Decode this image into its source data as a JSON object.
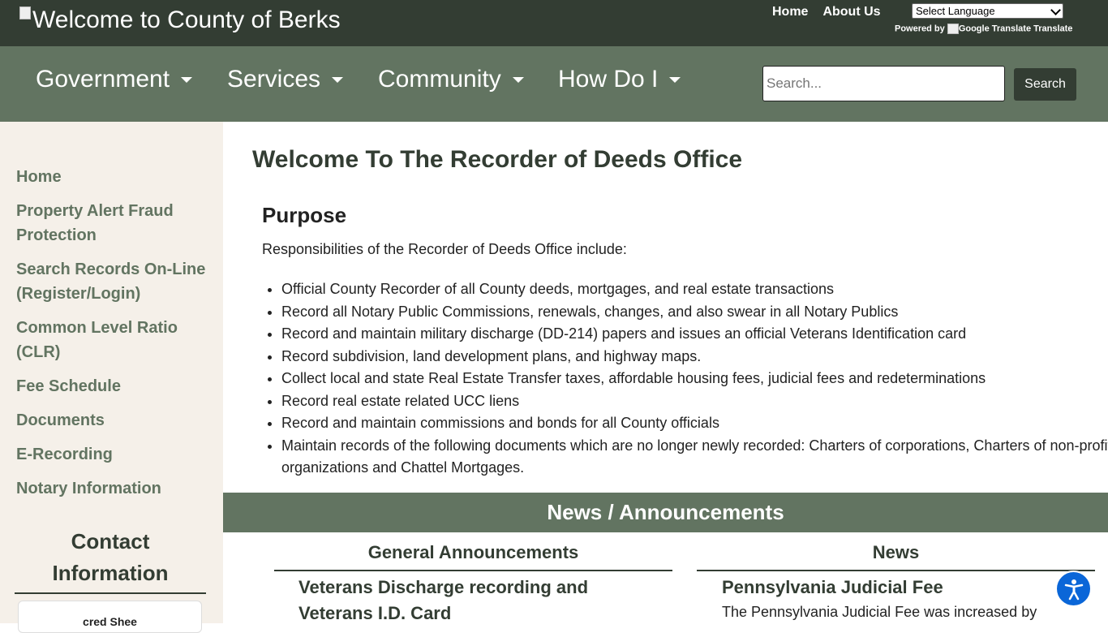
{
  "header": {
    "logo_text": "Welcome to County of Berks",
    "links": [
      "Home",
      "About Us"
    ],
    "language_select": "Select Language",
    "powered_by": "Powered by",
    "google_translate": "Google Translate",
    "translate": "Translate"
  },
  "nav": {
    "items": [
      "Government",
      "Services",
      "Community",
      "How Do I"
    ],
    "search_placeholder": "Search...",
    "search_button": "Search"
  },
  "sidebar": {
    "links": [
      "Home",
      "Property Alert Fraud Protection",
      "Search Records On-Line (Register/Login)",
      "Common Level Ratio (CLR)",
      "Fee Schedule",
      "Documents",
      "E-Recording",
      "Notary Information"
    ],
    "contact_heading": "Contact Information",
    "card_text": "cred Shee"
  },
  "main": {
    "title": "Welcome To The Recorder of Deeds Office",
    "purpose_heading": "Purpose",
    "intro": "Responsibilities of the Recorder of Deeds Office include:",
    "responsibilities": [
      "Official County Recorder of all County deeds, mortgages, and real estate transactions",
      "Record all Notary Public Commissions, renewals, changes, and also swear in all Notary Publics",
      "Record and maintain military discharge (DD-214) papers and issues an official Veterans Identification card",
      "Record subdivision, land development plans, and highway maps.",
      "Collect local and state Real Estate Transfer taxes, affordable housing fees, judicial fees and redeterminations",
      "Record real estate related UCC liens",
      "Record and maintain commissions and bonds for all County officials",
      "Maintain records of the following documents which are no longer newly recorded: Charters of corporations, Charters of non-profit organizations and Chattel Mortgages."
    ]
  },
  "news": {
    "bar_title": "News / Announcements",
    "general_heading": "General Announcements",
    "news_heading": "News",
    "announcement_title": "Veterans Discharge recording and Veterans I.D. Card",
    "news_item_title": "Pennsylvania Judicial Fee",
    "news_item_text": "The Pennsylvania Judicial Fee was increased by"
  },
  "icons": {
    "accessibility": "accessibility-icon",
    "caret": "caret-down-icon"
  },
  "colors": {
    "dark_green": "#333d33",
    "sage_green": "#627461",
    "sidebar_bg": "#f5f0e9",
    "accessibility_blue": "#0a66d8"
  }
}
